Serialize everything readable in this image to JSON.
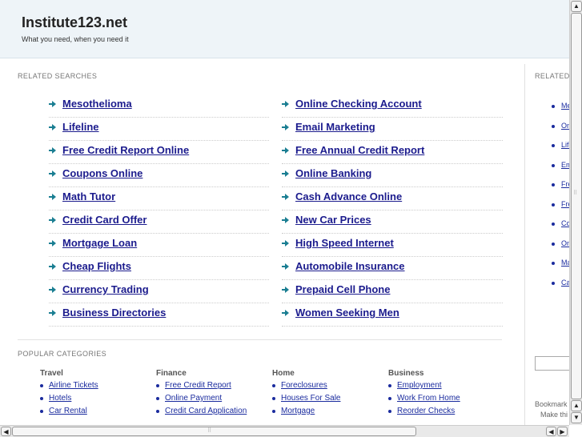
{
  "header": {
    "title": "Institute123.net",
    "tagline": "What you need, when you need it"
  },
  "related": {
    "label": "RELATED SEARCHES",
    "left": [
      "Mesothelioma",
      "Lifeline",
      "Free Credit Report Online",
      "Coupons Online",
      "Math Tutor",
      "Credit Card Offer",
      "Mortgage Loan",
      "Cheap Flights",
      "Currency Trading",
      "Business Directories"
    ],
    "right": [
      "Online Checking Account",
      "Email Marketing",
      "Free Annual Credit Report",
      "Online Banking",
      "Cash Advance Online",
      "New Car Prices",
      "High Speed Internet",
      "Automobile Insurance",
      "Prepaid Cell Phone",
      "Women Seeking Men"
    ]
  },
  "popular": {
    "label": "POPULAR CATEGORIES",
    "columns": [
      {
        "heading": "Travel",
        "items": [
          "Airline Tickets",
          "Hotels",
          "Car Rental"
        ]
      },
      {
        "heading": "Finance",
        "items": [
          "Free Credit Report",
          "Online Payment",
          "Credit Card Application"
        ]
      },
      {
        "heading": "Home",
        "items": [
          "Foreclosures",
          "Houses For Sale",
          "Mortgage"
        ]
      },
      {
        "heading": "Business",
        "items": [
          "Employment",
          "Work From Home",
          "Reorder Checks"
        ]
      }
    ]
  },
  "sidebar": {
    "label": "RELATED",
    "items": [
      "Me",
      "On",
      "Life",
      "Em",
      "Fre",
      "Fre",
      "Co",
      "On",
      "Ma",
      "Ca"
    ],
    "bookmark": "Bookmark",
    "make_this": "Make thi"
  },
  "scrollbars": {
    "up_glyph": "▲",
    "down_glyph": "▼",
    "left_glyph": "◀",
    "right_glyph": "▶",
    "grip_glyph": "⠿"
  }
}
